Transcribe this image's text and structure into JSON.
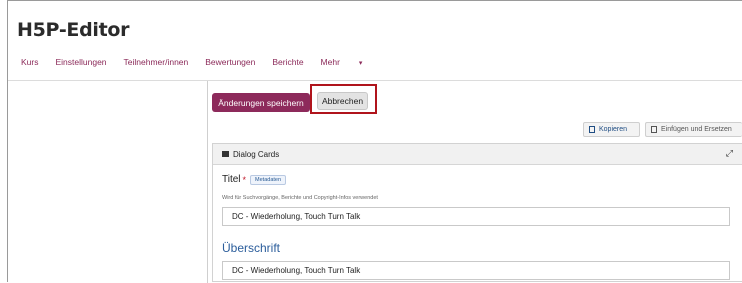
{
  "header": {
    "title": "H5P-Editor"
  },
  "nav": {
    "items": [
      "Kurs",
      "Einstellungen",
      "Teilnehmer/innen",
      "Bewertungen",
      "Berichte"
    ],
    "more": "Mehr",
    "more_caret": "▾"
  },
  "actions": {
    "save_label": "Änderungen speichern",
    "cancel_label": "Abbrechen",
    "copy_label": "Kopieren",
    "paste_label": "Einfügen und Ersetzen"
  },
  "panel": {
    "title": "Dialog Cards",
    "expand_glyph": "⤢",
    "title_field": {
      "label": "Titel",
      "required_mark": "*",
      "metadata_label": "Metadaten",
      "description": "Wird für Suchvorgänge, Berichte und Copyright-Infos verwendet",
      "value": "DC - Wiederholung, Touch Turn Talk"
    },
    "heading_field": {
      "label": "Überschrift",
      "value": "DC - Wiederholung, Touch Turn Talk"
    }
  },
  "colors": {
    "accent": "#8d2a5b",
    "highlight": "#b0141c",
    "link": "#2b5d9b"
  }
}
